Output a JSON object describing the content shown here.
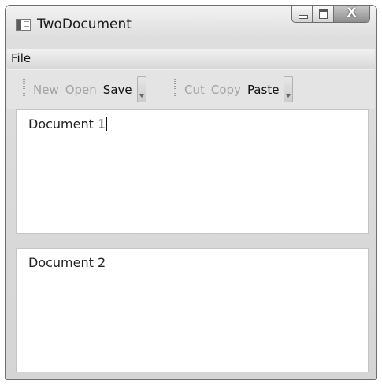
{
  "window": {
    "title": "TwoDocument"
  },
  "caption_buttons": {
    "close_glyph": "X"
  },
  "menu": {
    "items": [
      {
        "label": "File"
      }
    ]
  },
  "toolbars": [
    {
      "buttons": [
        {
          "label": "New",
          "enabled": false
        },
        {
          "label": "Open",
          "enabled": false
        },
        {
          "label": "Save",
          "enabled": true
        }
      ]
    },
    {
      "buttons": [
        {
          "label": "Cut",
          "enabled": false
        },
        {
          "label": "Copy",
          "enabled": false
        },
        {
          "label": "Paste",
          "enabled": true
        }
      ]
    }
  ],
  "documents": [
    {
      "text": "Document 1",
      "focused": true
    },
    {
      "text": "Document 2",
      "focused": false
    }
  ]
}
